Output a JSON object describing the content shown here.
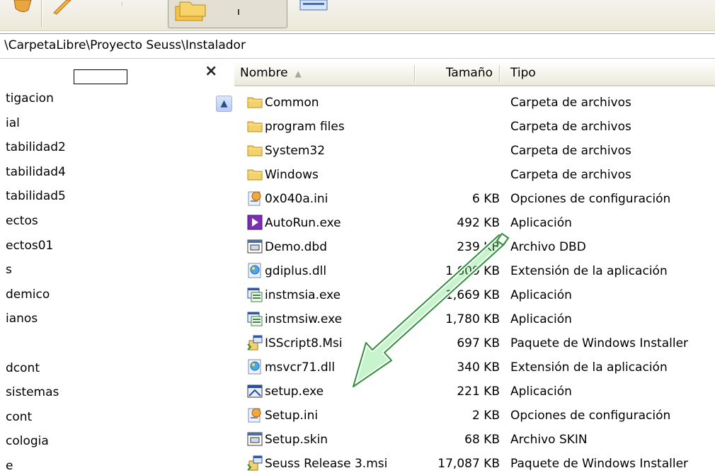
{
  "address": {
    "path": "\\CarpetaLibre\\Proyecto Seuss\\Instalador"
  },
  "folder_pane": {
    "close_label": "×",
    "items": [
      "tigacion",
      "ial",
      "tabilidad2",
      "tabilidad4",
      "tabilidad5",
      "ectos",
      "ectos01",
      "s",
      "demico",
      "ianos",
      "",
      "dcont",
      "sistemas",
      "cont",
      "cologia",
      "e"
    ]
  },
  "columns": {
    "name": "Nombre",
    "size": "Tamaño",
    "type": "Tipo"
  },
  "files": [
    {
      "name": "Common",
      "size": "",
      "type": "Carpeta de archivos",
      "icon": "folder-icon"
    },
    {
      "name": "program files",
      "size": "",
      "type": "Carpeta de archivos",
      "icon": "folder-icon"
    },
    {
      "name": "System32",
      "size": "",
      "type": "Carpeta de archivos",
      "icon": "folder-icon"
    },
    {
      "name": "Windows",
      "size": "",
      "type": "Carpeta de archivos",
      "icon": "folder-icon"
    },
    {
      "name": "0x040a.ini",
      "size": "6 KB",
      "type": "Opciones de configuración",
      "icon": "ini-file-icon"
    },
    {
      "name": "AutoRun.exe",
      "size": "492 KB",
      "type": "Aplicación",
      "icon": "autorun-app-icon"
    },
    {
      "name": "Demo.dbd",
      "size": "239 KB",
      "type": "Archivo DBD",
      "icon": "window-file-icon"
    },
    {
      "name": "gdiplus.dll",
      "size": "1,609 KB",
      "type": "Extensión de la aplicación",
      "icon": "dll-file-icon"
    },
    {
      "name": "instmsia.exe",
      "size": "1,669 KB",
      "type": "Aplicación",
      "icon": "installer-exe-icon"
    },
    {
      "name": "instmsiw.exe",
      "size": "1,780 KB",
      "type": "Aplicación",
      "icon": "installer-exe-icon"
    },
    {
      "name": "ISScript8.Msi",
      "size": "697 KB",
      "type": "Paquete de Windows Installer",
      "icon": "msi-package-icon"
    },
    {
      "name": "msvcr71.dll",
      "size": "340 KB",
      "type": "Extensión de la aplicación",
      "icon": "dll-file-icon"
    },
    {
      "name": "setup.exe",
      "size": "221 KB",
      "type": "Aplicación",
      "icon": "setup-exe-icon"
    },
    {
      "name": "Setup.ini",
      "size": "2 KB",
      "type": "Opciones de configuración",
      "icon": "ini-file-icon"
    },
    {
      "name": "Setup.skin",
      "size": "68 KB",
      "type": "Archivo SKIN",
      "icon": "window-file-icon"
    },
    {
      "name": "Seuss Release 3.msi",
      "size": "17,087 KB",
      "type": "Paquete de Windows Installer",
      "icon": "msi-package-icon"
    }
  ],
  "colors": {
    "annotation_arrow": "#62e070",
    "folder_yellow": "#f3d16b",
    "header_bg": "#ebeadb"
  }
}
